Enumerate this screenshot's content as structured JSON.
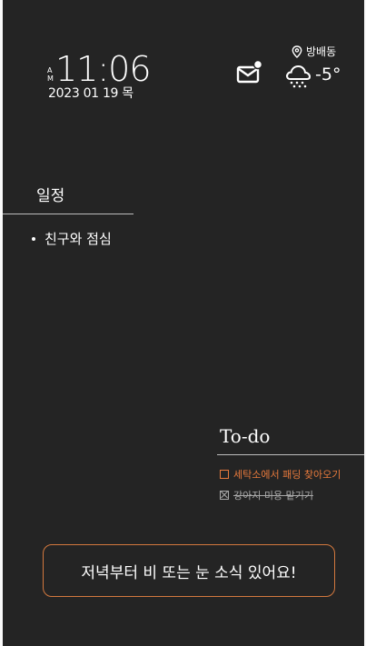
{
  "clock": {
    "am": "A",
    "pm": "M",
    "time": "11:06",
    "date": "2023 01 19 목"
  },
  "weather": {
    "location": "방배동",
    "temperature": "-5°",
    "icon": "snow-cloud-icon"
  },
  "notifications": {
    "icon": "mail-badge-icon"
  },
  "schedule": {
    "title": "일정",
    "items": [
      "친구와 점심"
    ]
  },
  "todo": {
    "title": "To-do",
    "items": [
      {
        "text": "세탁소에서 패딩 찾아오기",
        "done": false
      },
      {
        "text": "강아지 미용 맡기기",
        "done": true
      }
    ]
  },
  "banner": {
    "message": "저녁부터 비 또는 눈 소식 있어요!"
  },
  "colors": {
    "background": "#242424",
    "accent": "#e87a3c",
    "done_text": "#a9a9a9"
  }
}
